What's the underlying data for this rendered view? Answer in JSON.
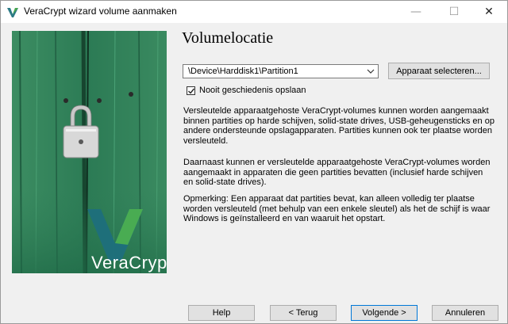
{
  "window": {
    "title": "VeraCrypt wizard volume aanmaken",
    "minimize_glyph": "—",
    "maximize_glyph": "☐",
    "close_glyph": "✕"
  },
  "side_image": {
    "brand": "VeraCrypt",
    "description": ""
  },
  "page": {
    "heading": "Volumelocatie"
  },
  "device": {
    "value": "\\Device\\Harddisk1\\Partition1",
    "select_button": "Apparaat selecteren..."
  },
  "history": {
    "label": "Nooit geschiedenis opslaan",
    "checked": true
  },
  "info": {
    "paragraph1": "Versleutelde apparaatgehoste VeraCrypt-volumes kunnen worden aangemaakt binnen partities op harde schijven, solid-state drives, USB-geheugensticks en op andere ondersteunde opslagapparaten. Partities kunnen ook ter plaatse worden versleuteld.",
    "paragraph2": "Daarnaast kunnen er versleutelde apparaatgehoste VeraCrypt-volumes worden aangemaakt in apparaten die geen partities bevatten (inclusief harde schijven en solid-state drives).",
    "paragraph3": "Opmerking: Een apparaat dat partities bevat, kan alleen volledig ter plaatse worden versleuteld (met behulp van een enkele sleutel) als het de schijf is waar Windows is geïnstalleerd en van waaruit het opstart."
  },
  "buttons": {
    "help": "Help",
    "back": "< Terug",
    "next": "Volgende >",
    "cancel": "Annuleren"
  },
  "colors": {
    "accent": "#0078d7",
    "brand_green": "#2f7a57"
  },
  "icons": {
    "app": "veracrypt-logo-icon",
    "dropdown": "chevron-down-icon",
    "checkbox": "checkmark-icon"
  }
}
